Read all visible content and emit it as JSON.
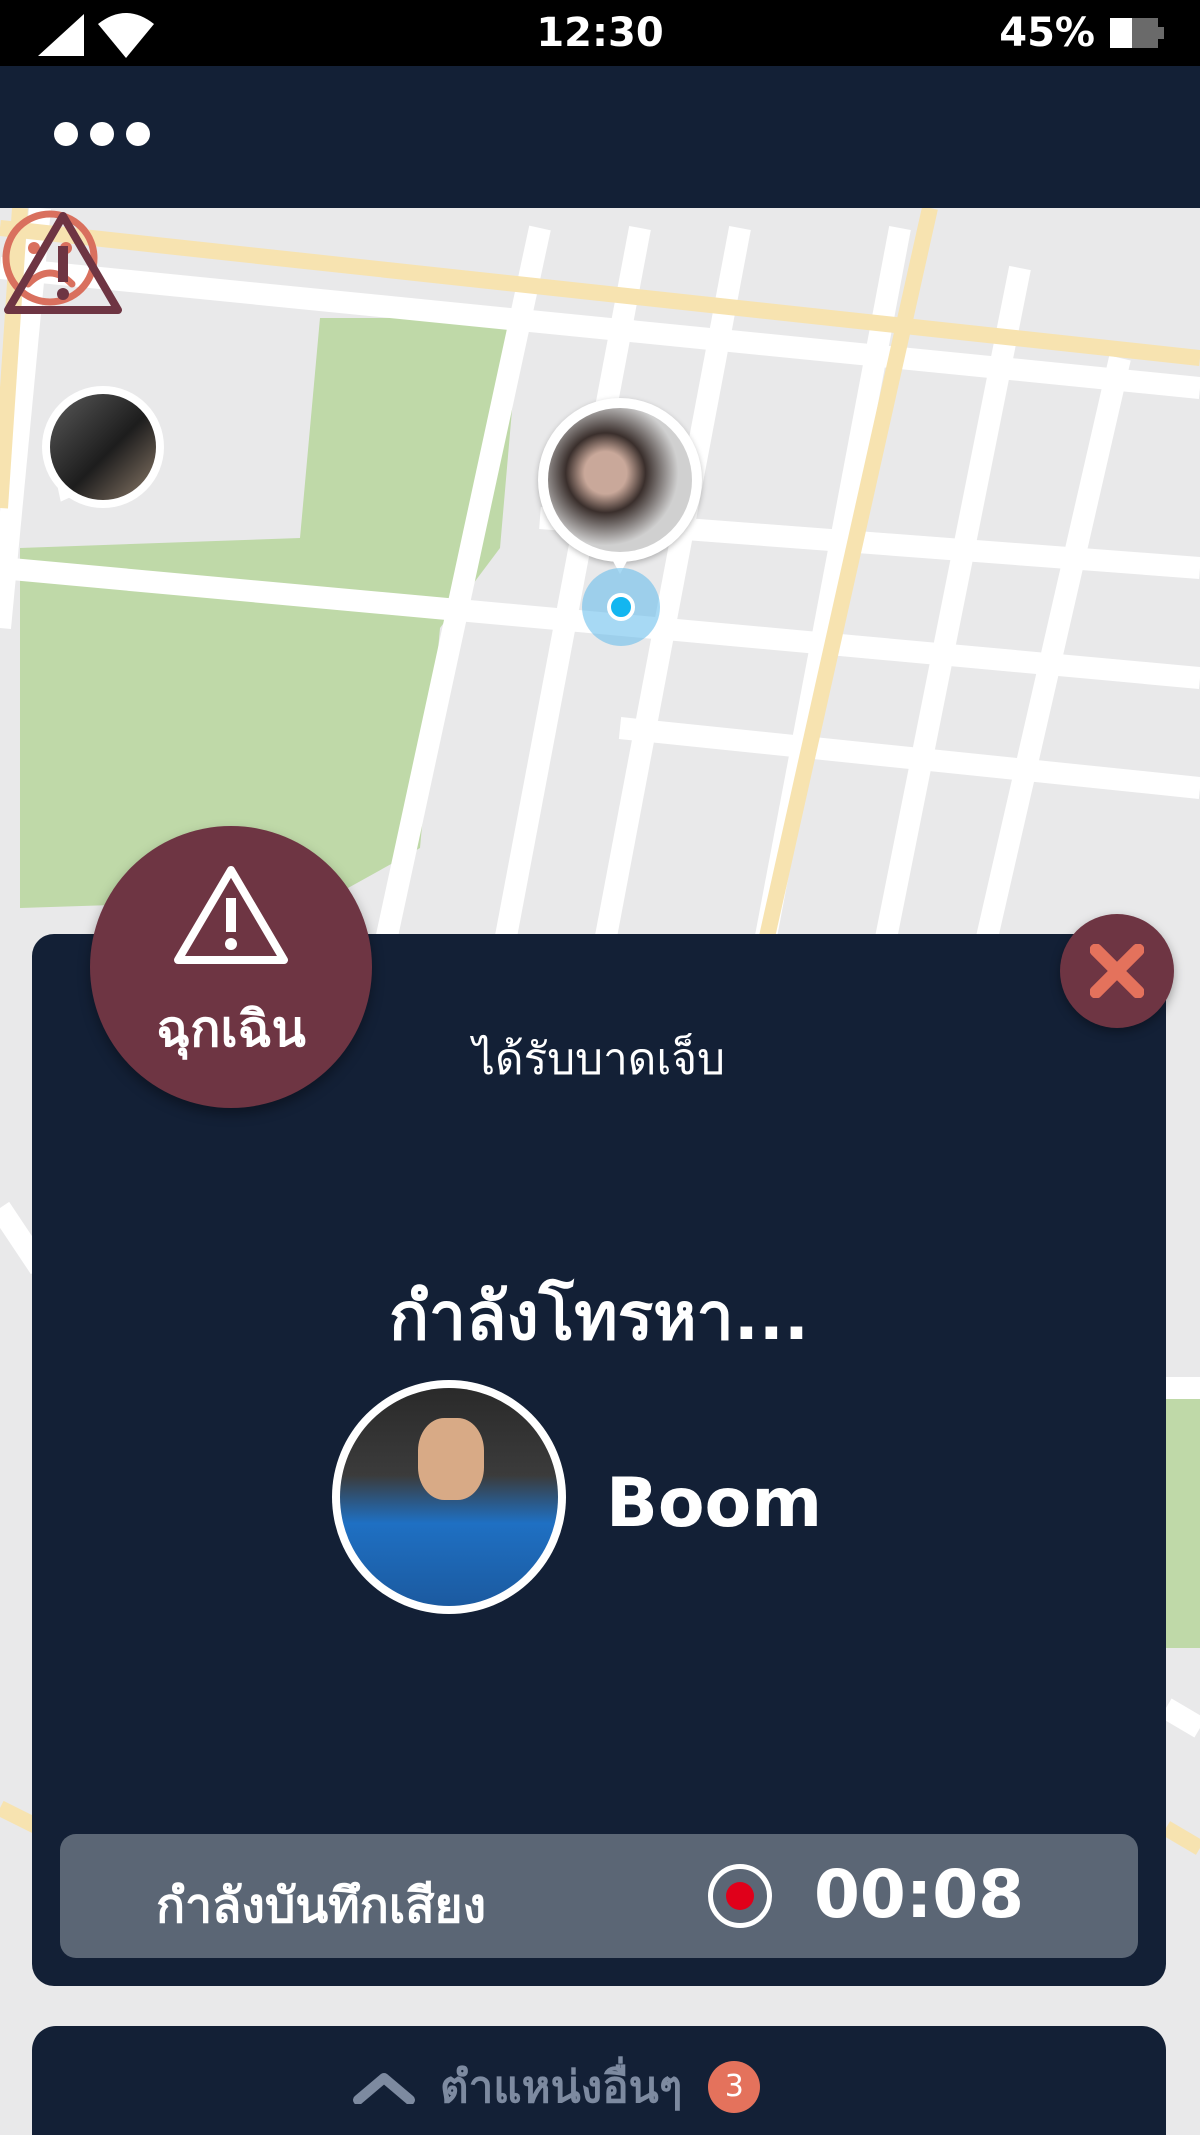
{
  "status_bar": {
    "time": "12:30",
    "battery_percent": "45%",
    "icons": [
      "signal-icon",
      "wifi-icon",
      "battery-icon"
    ]
  },
  "header": {
    "menu_icon": "more-dots-icon"
  },
  "map": {
    "markers": [
      {
        "type": "sad-face-icon",
        "color": "#d9705e"
      },
      {
        "type": "warning-icon",
        "color": "#6e3543"
      },
      {
        "type": "current-location-dot",
        "color": "#13b6f0"
      }
    ]
  },
  "emergency": {
    "badge_label": "ฉุกเฉิน",
    "reason": "ได้รับบาดเจ็บ",
    "calling_text": "กำลังโทรหา...",
    "contact_name": "Boom",
    "recording_label": "กำลังบันทึกเสียง",
    "recording_time": "00:08"
  },
  "bottom_sheet": {
    "label": "ตำแหน่งอื่นๆ",
    "badge_count": "3"
  },
  "colors": {
    "navy": "#132036",
    "emergency": "#6e3543",
    "record_red": "#e0001a",
    "badge": "#e4725c",
    "park_green": "#bfd9a8",
    "road_yellow": "#f7e3b0"
  }
}
